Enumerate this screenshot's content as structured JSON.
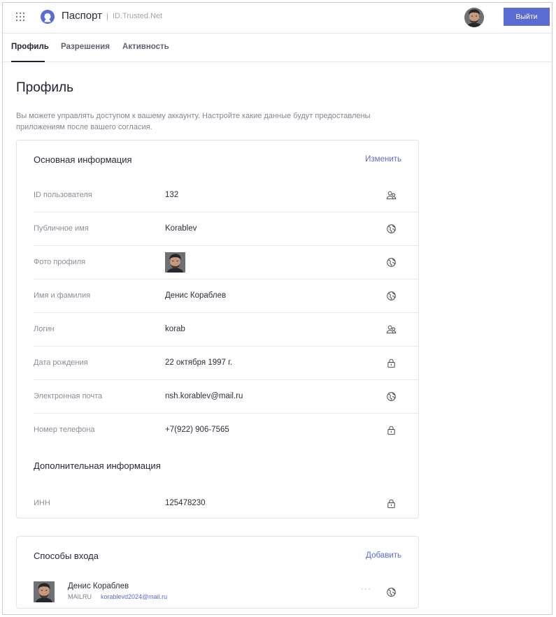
{
  "header": {
    "brand": "Паспорт",
    "separator": "|",
    "domain": "ID.Trusted.Net",
    "logout_label": "Выйти"
  },
  "tabs": [
    {
      "label": "Профиль",
      "active": true
    },
    {
      "label": "Разрешения",
      "active": false
    },
    {
      "label": "Активность",
      "active": false
    }
  ],
  "page": {
    "title": "Профиль",
    "description": "Вы можете управлять доступом к вашему аккаунту. Настройте какие данные будут предоставлены приложениям после вашего согласия."
  },
  "basic_info": {
    "title": "Основная информация",
    "action_label": "Изменить",
    "rows": [
      {
        "label": "ID пользователя",
        "value": "132",
        "icon": "users-icon"
      },
      {
        "label": "Публичное имя",
        "value": "Korablev",
        "icon": "globe-icon"
      },
      {
        "label": "Фото профиля",
        "value": "",
        "icon": "globe-icon"
      },
      {
        "label": "Имя и фамилия",
        "value": "Денис Кораблев",
        "icon": "globe-icon"
      },
      {
        "label": "Логин",
        "value": "korab",
        "icon": "users-icon"
      },
      {
        "label": "Дата рождения",
        "value": "22 октября 1997 г.",
        "icon": "lock-icon"
      },
      {
        "label": "Электронная почта",
        "value": "nsh.korablev@mail.ru",
        "icon": "globe-icon"
      },
      {
        "label": "Номер телефона",
        "value": "+7(922) 906-7565",
        "icon": "lock-icon"
      }
    ],
    "extra_title": "Дополнительная информация",
    "extra_rows": [
      {
        "label": "ИНН",
        "value": "125478230",
        "icon": "lock-icon"
      }
    ]
  },
  "login_methods": {
    "title": "Способы входа",
    "action_label": "Добавить",
    "items": [
      {
        "name": "Денис Кораблев",
        "provider": "MAILRU",
        "email": "korablevd2024@mail.ru",
        "more": "···"
      }
    ]
  },
  "colors": {
    "accent": "#5a6cd1",
    "text": "#262a3b",
    "muted": "#8a8e9a"
  }
}
